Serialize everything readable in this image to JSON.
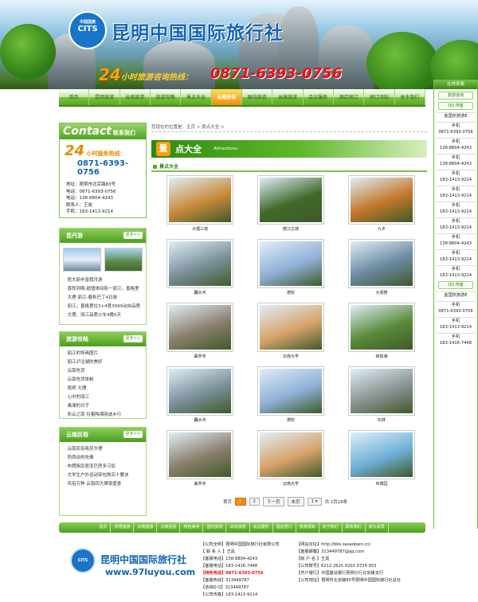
{
  "header": {
    "logo_text": "CITS",
    "logo_sub": "中国国旅",
    "site_title": "昆明中国国际旅行社",
    "hotline_24": "24",
    "hotline_label": "小时旅游咨询热线：",
    "hotline_number": "0871-6393-0756"
  },
  "nav": {
    "items": [
      "首页",
      "昆明旅游",
      "云南旅游",
      "旅游攻略",
      "景点大全",
      "云南民俗",
      "国内旅游",
      "出境旅游",
      "会议服务",
      "酒店预订",
      "预订须知",
      "关于我们"
    ],
    "active_index": 5
  },
  "contact": {
    "head_big": "Contact",
    "head_small": "联系我们",
    "hours_num": "24",
    "hours_label": "小时服务热线：",
    "phone": "0871-6393-0756",
    "lines": [
      "地址：昆明市北京路83号",
      "电话：0871-6393-0756",
      "电话：138-8804-4243",
      "联系人：王晁",
      "手机：183-1413-9214"
    ]
  },
  "box_yunnan": {
    "title": "昆丹游",
    "more": "更多>>",
    "items": [
      "昆大丽丰富假月游",
      "喜郎到哦-超值体间影一丽江，香格里",
      "大理-丽江-春秋巴丁4日游",
      "丽江，香格里拉3+4意3999动自品质",
      "大理，丽江品质火车4晚5天"
    ]
  },
  "box_guide": {
    "title": "旅游攻略",
    "more": "更多>>",
    "items": [
      "丽江的饰画图片",
      "丽江泸沽湖的美好",
      "云南吃货",
      "云南吃货体制",
      "昆明 大理",
      "心中的丽江",
      "乘湘的日子",
      "彩云之南 拉着陶湘丽迪乡行"
    ]
  },
  "box_folk": {
    "title": "云南民俗",
    "more": "更多>>",
    "items": [
      "云南民俗吸尼尔理",
      "奶西谈的吃傣",
      "布朗族民居泥巴房多习俗",
      "大学生户外运动穿包购买十要诀",
      "风俗万种 云南四大撵夜盛景"
    ]
  },
  "main": {
    "crumb": "您现在的位置是：主页 > 景点大全 >",
    "banner_icon": "景",
    "banner_title": "点大全",
    "banner_en": "Attractions",
    "subhead": "景点大全",
    "spots": [
      {
        "name": "大理三塔",
        "color": "#c98a3a"
      },
      {
        "name": "丽江古城",
        "color": "#3f6a2a"
      },
      {
        "name": "九乡",
        "color": "#c4762a"
      },
      {
        "name": "轟水河",
        "color": "#7a8f9a"
      },
      {
        "name": "德钦",
        "color": "#8fb0d6"
      },
      {
        "name": "大观楼",
        "color": "#6a88a0"
      },
      {
        "name": "曲界寺",
        "color": "#8a7e6a"
      },
      {
        "name": "云南大学",
        "color": "#d8a36a"
      },
      {
        "name": "纳帕海",
        "color": "#5a8a3a"
      },
      {
        "name": "轟水河",
        "color": "#7a8f9a"
      },
      {
        "name": "德钦",
        "color": "#8fb0d6"
      },
      {
        "name": "石林",
        "color": "#8a9190"
      },
      {
        "name": "曲界寺",
        "color": "#8a7e6a"
      },
      {
        "name": "云南大学",
        "color": "#d8a36a"
      },
      {
        "name": "世博园",
        "color": "#6fb0d8"
      }
    ],
    "pager": {
      "home": "首页",
      "pages": [
        "1",
        "2"
      ],
      "current": "1",
      "next": "下一页",
      "last": "末页",
      "select_value": "1",
      "summary": "共 2页18条"
    }
  },
  "footer": {
    "nav": [
      "首页",
      "昆明旅游",
      "云南旅游",
      "云南民俗",
      "特色美食",
      "国内旅游",
      "出境旅游",
      "会议服务",
      "酒店预订",
      "旅游须知",
      "关于我们",
      "联系我们",
      "成为会员"
    ],
    "logo_name": "昆明中国国际旅行社",
    "url": "www.97luyou.com",
    "col1": [
      "【公司全称】昆明中国国际旅行社有限公司",
      "【 联 系 人 】王晁",
      "【客服电话】138-8804-4243",
      "【客服电话】183-1416-7448",
      "【特色电话】0871-6393-0756",
      "【客服热线】313449787",
      "【咨询Q Q】313449787",
      "【公司传真】183-1413-9214"
    ],
    "col2": [
      "【网站论坛】http://bbs.sasadown.cn/",
      "【客服邮箱】313449787@qq.com",
      "【帐 户 名 】王晁",
      "【公司账号】6212 2625 0202 0734 953",
      "【开户银行】中国建设银行昆明分行北京路支行",
      "【公司地址】昆明市北京路83号昆明中国国际旅行社总社"
    ]
  },
  "side": {
    "head": "在线客服",
    "btn1": "旅游咨询",
    "btn2": "QQ 传客",
    "company": "金国庆旅游E",
    "entries": [
      {
        "label": "手机",
        "value": "0871-6393-0756"
      },
      {
        "label": "手机",
        "value": "138-8804-4243"
      },
      {
        "label": "手机",
        "value": "138-8804-4243"
      },
      {
        "label": "手机",
        "value": "183-1413-9214"
      },
      {
        "label": "手机",
        "value": "183-1413-9214"
      },
      {
        "label": "手机",
        "value": "183-1413-9214"
      },
      {
        "label": "手机",
        "value": "183-1413-9214"
      },
      {
        "label": "手机",
        "value": "138-8804-4243"
      },
      {
        "label": "手机",
        "value": "183-1413-9214"
      },
      {
        "label": "手机",
        "value": "183-1413-9214"
      }
    ],
    "btn3": "QQ 传客",
    "company2": "金国庆旅游E",
    "entries2": [
      {
        "label": "手机",
        "value": "0871-6393-0756"
      },
      {
        "label": "手机",
        "value": "183-1413-9214"
      },
      {
        "label": "手机",
        "value": "183-1416-7448"
      }
    ]
  },
  "colors": {
    "green": "#5aa923",
    "orange": "#f58a0b",
    "blue": "#1263b5",
    "red": "#e8101b"
  }
}
